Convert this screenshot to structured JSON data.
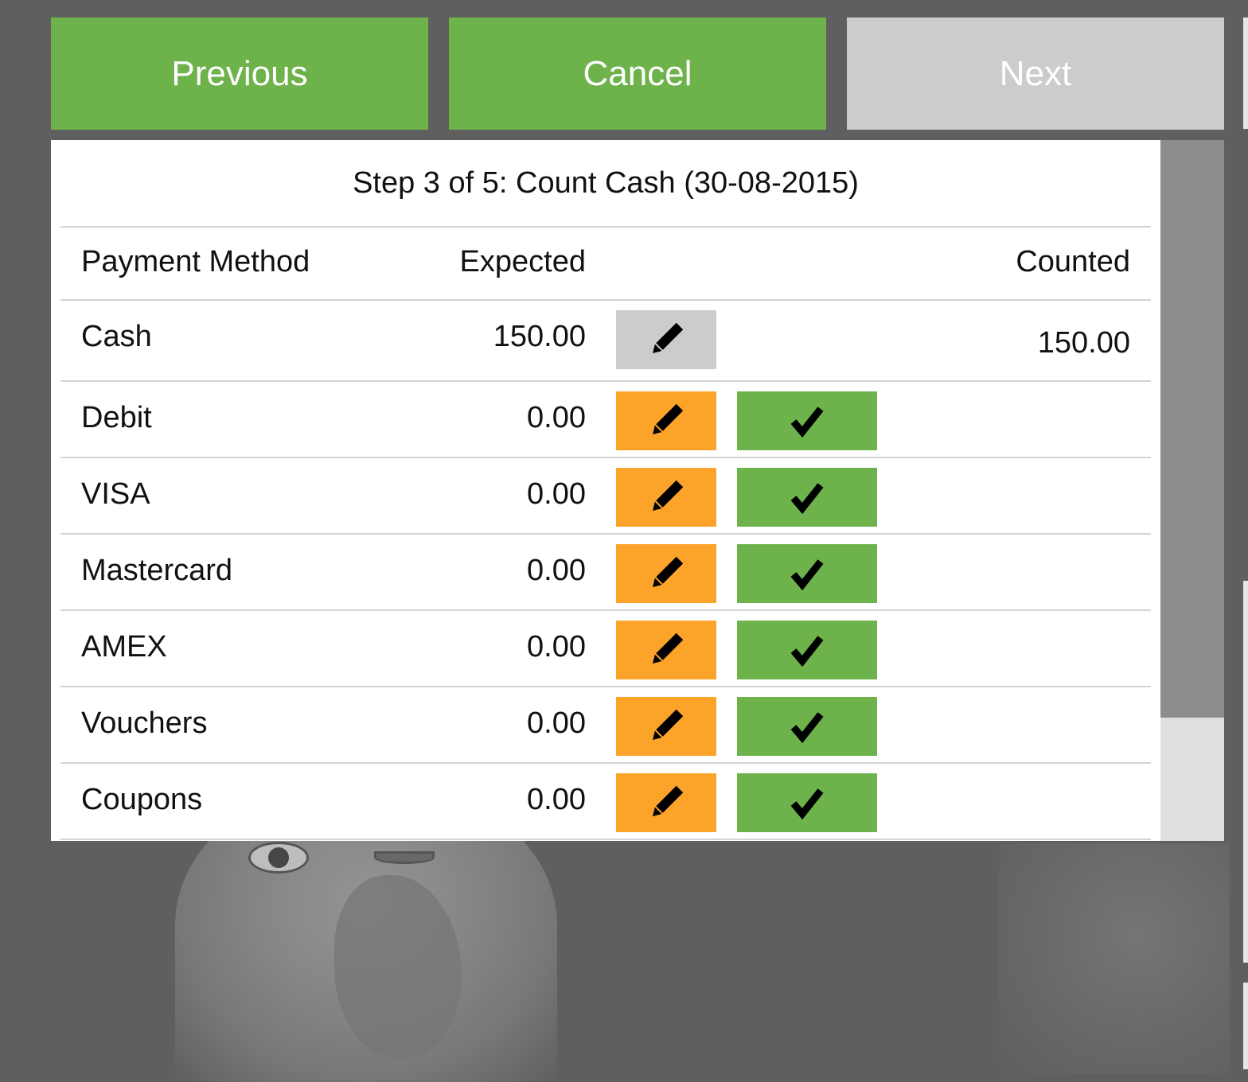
{
  "nav": {
    "previous_label": "Previous",
    "cancel_label": "Cancel",
    "next_label": "Next"
  },
  "dialog": {
    "title": "Step 3 of 5: Count Cash (30-08-2015)",
    "columns": {
      "method": "Payment Method",
      "expected": "Expected",
      "counted": "Counted"
    },
    "rows": [
      {
        "method": "Cash",
        "expected": "150.00",
        "counted": "150.00",
        "edit_state": "disabled"
      },
      {
        "method": "Debit",
        "expected": "0.00",
        "counted": ""
      },
      {
        "method": "VISA",
        "expected": "0.00",
        "counted": ""
      },
      {
        "method": "Mastercard",
        "expected": "0.00",
        "counted": ""
      },
      {
        "method": "AMEX",
        "expected": "0.00",
        "counted": ""
      },
      {
        "method": "Vouchers",
        "expected": "0.00",
        "counted": ""
      },
      {
        "method": "Coupons",
        "expected": "0.00",
        "counted": ""
      }
    ]
  },
  "colors": {
    "green": "#6db24b",
    "orange": "#fca329",
    "disabled": "#cccccc",
    "background": "#5f5f5f"
  },
  "icons": {
    "edit": "pencil-icon",
    "confirm": "checkmark-icon"
  }
}
